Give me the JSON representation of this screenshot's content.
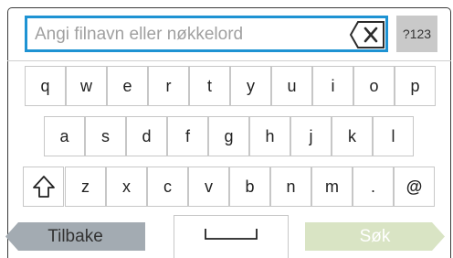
{
  "search": {
    "placeholder": "Angi filnavn eller nøkkelord",
    "value": ""
  },
  "icons": {
    "clear": "backspace-x-icon",
    "shift": "shift-arrow-icon",
    "space": "space-bar-icon"
  },
  "keyboard": {
    "mode_key": "?123",
    "row1": [
      "q",
      "w",
      "e",
      "r",
      "t",
      "y",
      "u",
      "i",
      "o",
      "p"
    ],
    "row2": [
      "a",
      "s",
      "d",
      "f",
      "g",
      "h",
      "j",
      "k",
      "l"
    ],
    "row3": [
      "z",
      "x",
      "c",
      "v",
      "b",
      "n",
      "m",
      ".",
      "@"
    ]
  },
  "footer": {
    "back_label": "Tilbake",
    "search_label": "Søk"
  },
  "colors": {
    "accent": "#1e93d3",
    "back_button": "#a3abb2",
    "search_button": "#d9e4c4",
    "mode_key": "#c9c9c9"
  }
}
